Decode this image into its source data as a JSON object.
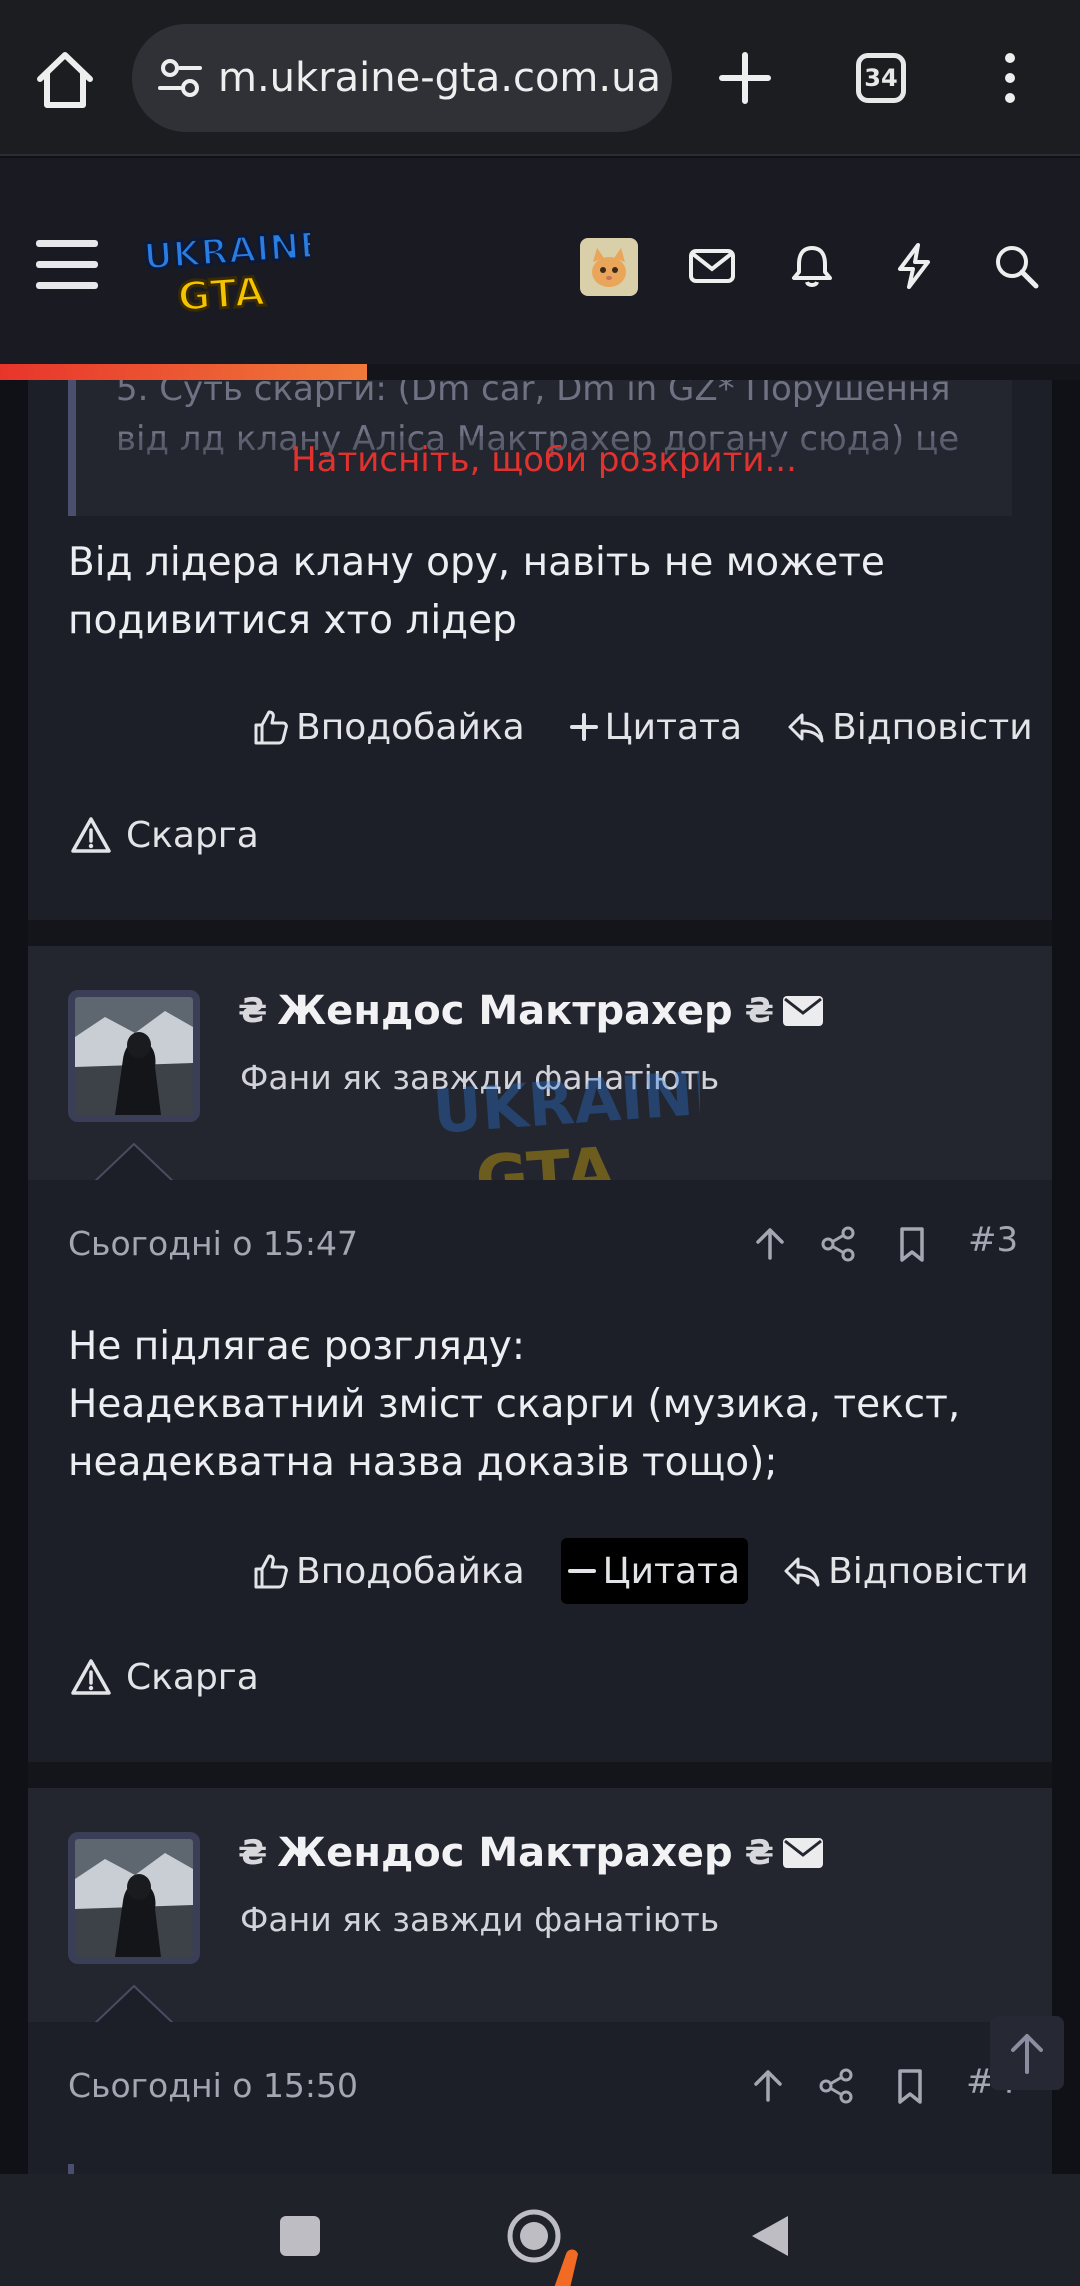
{
  "browser": {
    "url": "m.ukraine-gta.com.ua",
    "tab_count": "34"
  },
  "site": {
    "logo_alt": "UKRAINE GTA",
    "read_progress": 0.34,
    "accent": "#e8352b"
  },
  "post2": {
    "quote_text": "5. Суть скарги: (Dm car, Dm in GZ* Порушення від лд клану Аліса Мактрахер догану сюда) це",
    "expand_label": "Натисніть, щоби розкрити...",
    "message": "Від лідера клану ору, навіть не можете подивитися хто лідер",
    "like_label": "Вподобайка",
    "quote_label": "Цитата",
    "reply_label": "Відповісти",
    "report_label": "Скарга"
  },
  "post3": {
    "author": "Жендос Мактрахер",
    "user_title": "Фани як завжди фанатіють",
    "date": "Сьогодні о 15:47",
    "number": "#3",
    "message_line1": "Не підлягає розгляду:",
    "message_line2": "Неадекватний зміст скарги (музика, текст, неадекватна назва доказів тощо);",
    "like_label": "Вподобайка",
    "quote_label": "Цитата",
    "reply_label": "Відповісти",
    "report_label": "Скарга"
  },
  "post4": {
    "author": "Жендос Мактрахер",
    "user_title": "Фани як завжди фанатіють",
    "date": "Сьогодні о 15:50",
    "number": "#4"
  }
}
